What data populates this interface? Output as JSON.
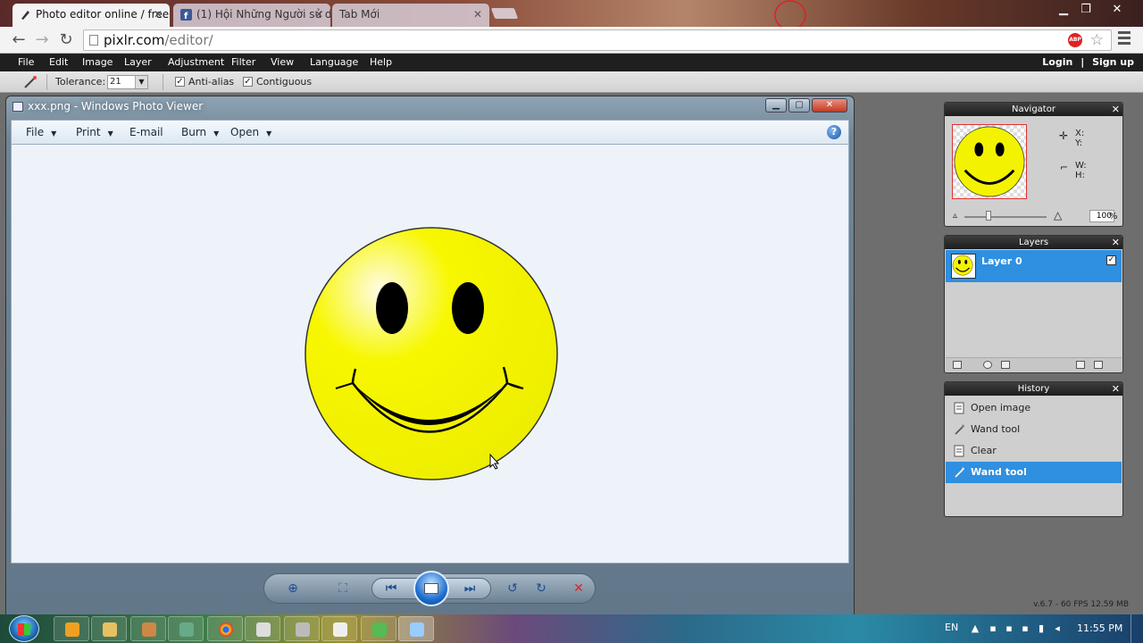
{
  "browser": {
    "tabs": [
      {
        "title": "Photo editor online / free",
        "active": true
      },
      {
        "title": "(1) Hội Những Người sử d",
        "active": false
      },
      {
        "title": "Tab Mới",
        "active": false
      }
    ],
    "url_host": "pixlr.com",
    "url_path": "/editor/",
    "abp_label": "ABP"
  },
  "pixlr": {
    "menu": [
      "File",
      "Edit",
      "Image",
      "Layer",
      "Adjustment",
      "Filter",
      "View",
      "Language",
      "Help"
    ],
    "login": "Login",
    "separator": "|",
    "signup": "Sign up",
    "tolerance_label": "Tolerance:",
    "tolerance_value": "21",
    "anti_alias_label": "Anti-alias",
    "contiguous_label": "Contiguous",
    "status": "v.6.7 - 60 FPS 12.59 MB"
  },
  "photo_viewer": {
    "title": "xxx.png - Windows Photo Viewer",
    "menu": [
      "File",
      "Print",
      "E-mail",
      "Burn",
      "Open"
    ],
    "help": "?"
  },
  "navigator": {
    "title": "Navigator",
    "x_label": "X:",
    "y_label": "Y:",
    "w_label": "W:",
    "h_label": "H:",
    "zoom": "100",
    "zoom_unit": "%"
  },
  "layers": {
    "title": "Layers",
    "items": [
      {
        "name": "Layer 0",
        "visible": true
      }
    ]
  },
  "history": {
    "title": "History",
    "items": [
      {
        "label": "Open image",
        "selected": false
      },
      {
        "label": "Wand tool",
        "selected": false
      },
      {
        "label": "Clear",
        "selected": false
      },
      {
        "label": "Wand tool",
        "selected": true
      }
    ]
  },
  "taskbar": {
    "language": "EN",
    "time": "11:55 PM"
  },
  "colors": {
    "accent": "#2f8fe0",
    "smiley": "#f7f700"
  }
}
